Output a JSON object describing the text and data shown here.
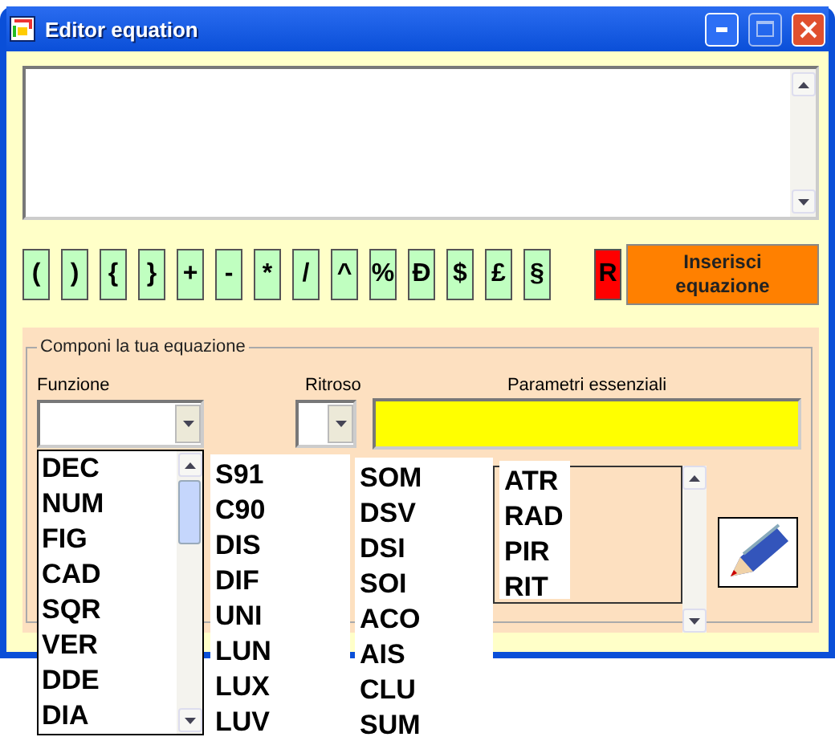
{
  "window": {
    "title": "Editor equation"
  },
  "symbol_buttons": [
    "(",
    ")",
    "{",
    "}",
    "+",
    "-",
    "*",
    "/",
    "^",
    "%",
    "Đ",
    "$",
    "£",
    "§"
  ],
  "reset_button": "R",
  "insert_button": "Inserisci equazione",
  "group": {
    "title": "Componi la tua equazione",
    "function_label": "Funzione",
    "ritroso_label": "Ritroso",
    "params_label": "Parametri essenziali"
  },
  "function_lists": [
    [
      "DEC",
      "NUM",
      "FIG",
      "CAD",
      "SQR",
      "VER",
      "DDE",
      "DIA"
    ],
    [
      "S91",
      "C90",
      "DIS",
      "DIF",
      "UNI",
      "LUN",
      "LUX",
      "LUV"
    ],
    [
      "SOM",
      "DSV",
      "DSI",
      "SOI",
      "ACO",
      "AIS",
      "CLU",
      "SUM"
    ],
    [
      "ATR",
      "RAD",
      "PIR",
      "RIT"
    ]
  ]
}
